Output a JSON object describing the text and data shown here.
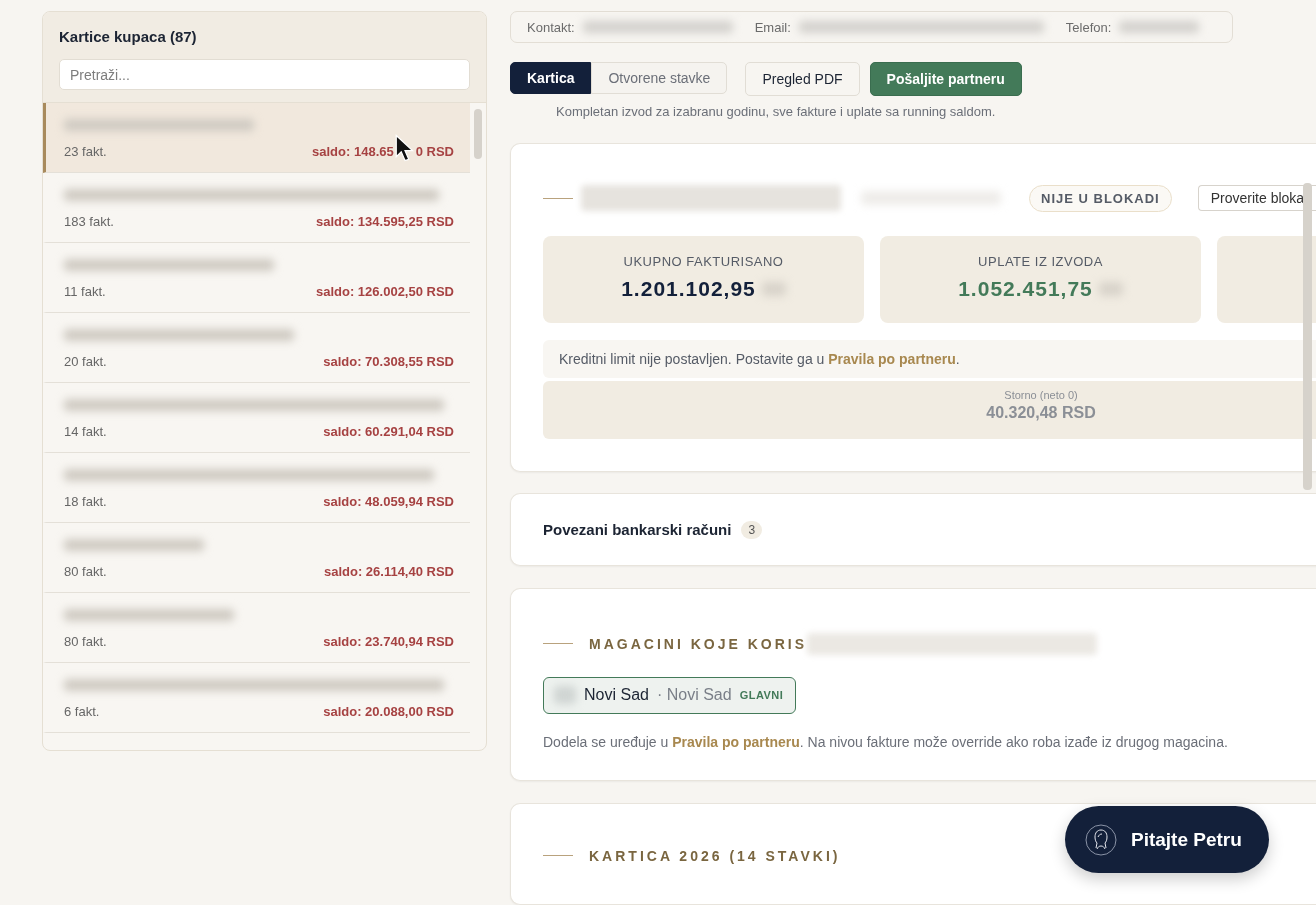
{
  "customer_list": {
    "title": "Kartice kupaca (87)",
    "search": {
      "placeholder": "Pretraži..."
    },
    "items": [
      {
        "invoices": "23 fakt.",
        "saldo": "saldo: 148.65",
        "saldo_tail": "0 RSD",
        "cursor_over": true,
        "selected": true
      },
      {
        "invoices": "183 fakt.",
        "saldo": "saldo: 134.595,25 RSD",
        "selected": false
      },
      {
        "invoices": "11 fakt.",
        "saldo": "saldo: 126.002,50 RSD",
        "selected": false
      },
      {
        "invoices": "20 fakt.",
        "saldo": "saldo: 70.308,55 RSD",
        "selected": false
      },
      {
        "invoices": "14 fakt.",
        "saldo": "saldo: 60.291,04 RSD",
        "selected": false
      },
      {
        "invoices": "18 fakt.",
        "saldo": "saldo: 48.059,94 RSD",
        "selected": false
      },
      {
        "invoices": "80 fakt.",
        "saldo": "saldo: 26.114,40 RSD",
        "selected": false
      },
      {
        "invoices": "80 fakt.",
        "saldo": "saldo: 23.740,94 RSD",
        "selected": false
      },
      {
        "invoices": "6 fakt.",
        "saldo": "saldo: 20.088,00 RSD",
        "selected": false
      }
    ]
  },
  "contact_bar": {
    "fields": [
      {
        "label": "Kontakt:"
      },
      {
        "label": "Email:"
      },
      {
        "label": "Telefon:"
      }
    ]
  },
  "view_tabs": [
    {
      "label": "Kartica",
      "selected": true
    },
    {
      "label": "Otvorene stavke",
      "selected": false
    }
  ],
  "actions": [
    {
      "label": "Pregled PDF",
      "kind": "secondary"
    },
    {
      "label": "Pošaljite partneru",
      "kind": "primary"
    }
  ],
  "caption": "Kompletan izvod za izabranu godinu, sve fakture i uplate sa running saldom.",
  "summary": {
    "block_badge": "NIJE U BLOKADI",
    "check_button": "Proverite bloka",
    "stats": [
      {
        "label": "UKUPNO FAKTURISANO",
        "value": "1.201.102,95",
        "kind": "neutral"
      },
      {
        "label": "UPLATE IZ IZVODA",
        "value": "1.052.451,75",
        "kind": "positive"
      }
    ],
    "credit_note": {
      "before": "Kreditni limit nije postavljen. Postavite ga u ",
      "link": "Pravila po partneru",
      "after": "."
    },
    "storno": {
      "label": "Storno (neto 0)",
      "value": "40.320,48 RSD"
    }
  },
  "bank_accounts": {
    "title": "Povezani bankarski računi",
    "count": "3"
  },
  "warehouses": {
    "title": "MAGACINI KOJE KORIS",
    "chips": [
      {
        "name": "Novi Sad",
        "city": "· Novi Sad",
        "badge": "GLAVNI"
      }
    ],
    "note": {
      "before": "Dodela se uređuje u ",
      "link": "Pravila po partneru",
      "after": ". Na nivou fakture može override ako roba izađe iz drugog magacina."
    }
  },
  "ledger": {
    "title": "KARTICA 2026 (14 STAVKI)"
  },
  "assistant_button": {
    "label": "Pitajte Petru"
  }
}
